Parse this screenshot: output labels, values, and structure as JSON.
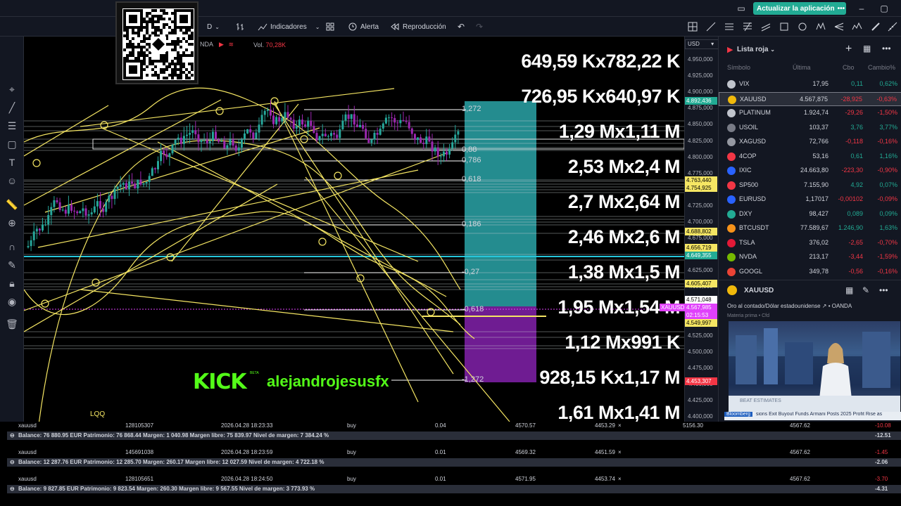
{
  "topbar": {
    "update_button": "Actualizar la aplicación",
    "update_dots": "•••"
  },
  "toolbar": {
    "interval": "D",
    "indicators": "Indicadores",
    "alert": "Alerta",
    "replay": "Reproducción"
  },
  "chart": {
    "symbol_partial": "NDA",
    "vol_label": "Vol.",
    "vol_value": "70,28K",
    "volume_labels": [
      "649,59 Kx782,22 K",
      "726,95 Kx640,97 K",
      "1,29 Mx1,11 M",
      "2,53 Mx2,4 M",
      "2,7 Mx2,64 M",
      "2,46 Mx2,6 M",
      "1,38 Mx1,5 M",
      "1,95 Mx1,54 M",
      "1,12 Mx991 K",
      "928,15 Kx1,17 M",
      "1,61 Mx1,41 M"
    ],
    "fib_labels": [
      "1,272",
      "0,88",
      "0,786",
      "0,618",
      "0,186",
      "-0,27",
      "-0,618",
      "-1,272"
    ],
    "kick_logo": "KICK",
    "kick_beta": "BETA",
    "kick_user": "alejandrojesusfx",
    "lqq": "LQQ"
  },
  "price_axis": {
    "currency": "USD",
    "ticks": [
      "4.950,000",
      "4.925,000",
      "4.900,000",
      "4.875,000",
      "4.850,000",
      "4.825,000",
      "4.800,000",
      "4.775,000",
      "4.750,000",
      "4.725,000",
      "4.700,000",
      "4.675,000",
      "4.650,000",
      "4.625,000",
      "4.600,000",
      "4.575,000",
      "4.550,000",
      "4.525,000",
      "4.500,000",
      "4.475,000",
      "4.450,000",
      "4.425,000",
      "4.400,000"
    ],
    "tags": [
      {
        "label": "4.892,436",
        "color": "#22ab94"
      },
      {
        "label": "4.763,440",
        "color": "#f5e663"
      },
      {
        "label": "4.754,925",
        "color": "#f5e663"
      },
      {
        "label": "4.688,802",
        "color": "#f5e663"
      },
      {
        "label": "4.656,719",
        "color": "#f5e663"
      },
      {
        "label": "4.649,355",
        "color": "#22ab94"
      },
      {
        "label": "4.605,407",
        "color": "#f5e663"
      },
      {
        "label": "4.571,048",
        "color": "#ffffff"
      },
      {
        "label": "4.567,985",
        "color": "#e040fb"
      },
      {
        "label": "02:15:53",
        "color": "#e040fb"
      },
      {
        "label": "4.549,997",
        "color": "#f5e663"
      },
      {
        "label": "4.453,307",
        "color": "#f23645"
      }
    ],
    "xauusd_tag": "XAUUSD"
  },
  "watchlist": {
    "title": "Lista roja",
    "headers": {
      "symbol": "Símbolo",
      "last": "Última",
      "change": "Cbo",
      "change_pct": "Cambio%"
    },
    "rows": [
      {
        "sym": "VIX",
        "last": "17,95",
        "chg": "0,11",
        "pct": "0,62%",
        "up": true,
        "color": "#c0c4cc"
      },
      {
        "sym": "XAUUSD",
        "last": "4.567,875",
        "chg": "-28,925",
        "pct": "-0,63%",
        "up": false,
        "color": "#f0b90b"
      },
      {
        "sym": "PLATINUM",
        "last": "1.924,74",
        "chg": "-29,26",
        "pct": "-1,50%",
        "up": false,
        "color": "#c0c4cc"
      },
      {
        "sym": "USOIL",
        "last": "103,37",
        "chg": "3,76",
        "pct": "3,77%",
        "up": true,
        "color": "#787b86"
      },
      {
        "sym": "XAGUSD",
        "last": "72,766",
        "chg": "-0,118",
        "pct": "-0,16%",
        "up": false,
        "color": "#9598a1"
      },
      {
        "sym": "4COP",
        "last": "53,16",
        "chg": "0,61",
        "pct": "1,16%",
        "up": true,
        "color": "#f23645"
      },
      {
        "sym": "IXIC",
        "last": "24.663,80",
        "chg": "-223,30",
        "pct": "-0,90%",
        "up": false,
        "color": "#2962ff"
      },
      {
        "sym": "SP500",
        "last": "7.155,90",
        "chg": "4,92",
        "pct": "0,07%",
        "up": true,
        "color": "#f23645"
      },
      {
        "sym": "EURUSD",
        "last": "1,17017",
        "chg": "-0,00102",
        "pct": "-0,09%",
        "up": false,
        "color": "#2962ff"
      },
      {
        "sym": "DXY",
        "last": "98,427",
        "chg": "0,089",
        "pct": "0,09%",
        "up": true,
        "color": "#22ab94"
      },
      {
        "sym": "BTCUSDT",
        "last": "77.589,67",
        "chg": "1.246,90",
        "pct": "1,63%",
        "up": true,
        "color": "#f7931a"
      },
      {
        "sym": "TSLA",
        "last": "376,02",
        "chg": "-2,65",
        "pct": "-0,70%",
        "up": false,
        "color": "#e31937"
      },
      {
        "sym": "NVDA",
        "last": "213,17",
        "chg": "-3,44",
        "pct": "-1,59%",
        "up": false,
        "color": "#76b900"
      },
      {
        "sym": "GOOGL",
        "last": "349,78",
        "chg": "-0,56",
        "pct": "-0,16%",
        "up": false,
        "color": "#ea4335"
      }
    ]
  },
  "detail": {
    "symbol": "XAUUSD",
    "description": "Oro al contado/Dólar estadounidense",
    "broker": "OANDA",
    "type": "Materia prima • Cfd",
    "ticker_brand": "Bloomberg",
    "ticker_text": "sions Exit Buyout Funds      Armani Posts 2025 Profit Rise as",
    "video_caption": "BEAT ESTIMATES"
  },
  "trades": [
    {
      "sym": "xauusd",
      "ticket": "128105307",
      "time": "2026.04.28 18:23:33",
      "side": "buy",
      "vol": "0.04",
      "open": "4570.57",
      "sl": "4453.29",
      "tp": "5156.30",
      "price": "4567.62",
      "profit": "-10.08",
      "balance": "Balance: 76 880.95 EUR  Patrimonio: 76 868.44  Margen: 1 040.98  Margen libre: 75 839.97  Nivel de margen: 7 384.24 %",
      "total": "-12.51"
    },
    {
      "sym": "xauusd",
      "ticket": "145691038",
      "time": "2026.04.28 18:23:59",
      "side": "buy",
      "vol": "0.01",
      "open": "4569.32",
      "sl": "4451.59",
      "tp": "",
      "price": "4567.62",
      "profit": "-1.45",
      "balance": "Balance: 12 287.76 EUR  Patrimonio: 12 285.70  Margen: 260.17  Margen libre: 12 027.59  Nivel de margen: 4 722.18 %",
      "total": "-2.06"
    },
    {
      "sym": "xauusd",
      "ticket": "128105651",
      "time": "2026.04.28 18:24:50",
      "side": "buy",
      "vol": "0.01",
      "open": "4571.95",
      "sl": "4453.74",
      "tp": "",
      "price": "4567.62",
      "profit": "-3.70",
      "balance": "Balance: 9 827.85 EUR  Patrimonio: 9 823.54  Margen: 260.30  Margen libre: 9 567.55  Nivel de margen: 3 773.93 %",
      "total": "-4.31"
    }
  ]
}
